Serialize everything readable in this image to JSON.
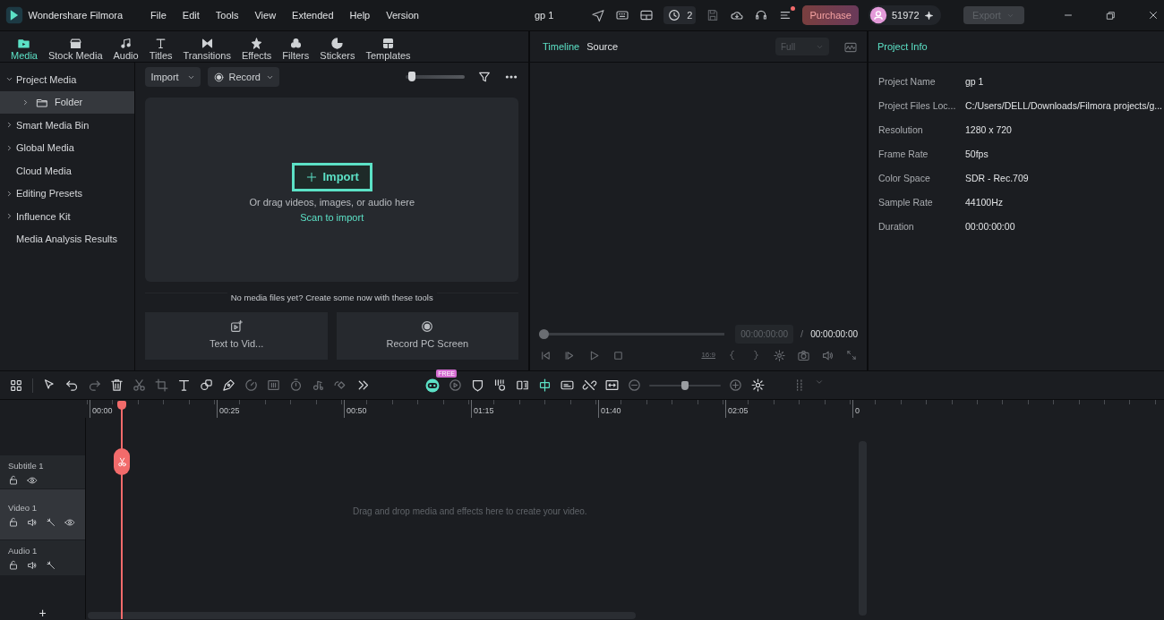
{
  "app": {
    "name": "Wondershare Filmora",
    "menu": [
      "File",
      "Edit",
      "Tools",
      "View",
      "Extended",
      "Help",
      "Version"
    ],
    "project_title": "gp 1",
    "undo_count": "2",
    "purchase": "Purchase",
    "credits": "51972",
    "export": {
      "label": "Export",
      "disabled": true
    }
  },
  "media_tabs": [
    {
      "kind": "media",
      "label": "Media",
      "selected": true
    },
    {
      "kind": "stock",
      "label": "Stock Media",
      "selected": false
    },
    {
      "kind": "audio",
      "label": "Audio",
      "selected": false
    },
    {
      "kind": "titles",
      "label": "Titles",
      "selected": false
    },
    {
      "kind": "transitions",
      "label": "Transitions",
      "selected": false
    },
    {
      "kind": "effects",
      "label": "Effects",
      "selected": false
    },
    {
      "kind": "filters",
      "label": "Filters",
      "selected": false
    },
    {
      "kind": "stickers",
      "label": "Stickers",
      "selected": false
    },
    {
      "kind": "templates",
      "label": "Templates",
      "selected": false
    }
  ],
  "sidebar": [
    {
      "label": "Project Media",
      "expandable": true,
      "expanded": true,
      "selected": false,
      "children": [
        {
          "label": "Folder",
          "expandable": true,
          "expanded": false,
          "selected": true
        }
      ]
    },
    {
      "label": "Smart Media Bin",
      "expandable": true,
      "expanded": false,
      "selected": false
    },
    {
      "label": "Global Media",
      "expandable": true,
      "expanded": false,
      "selected": false
    },
    {
      "label": "Cloud Media",
      "expandable": false,
      "selected": false
    },
    {
      "label": "Editing Presets",
      "expandable": true,
      "expanded": false,
      "selected": false
    },
    {
      "label": "Influence Kit",
      "expandable": true,
      "expanded": false,
      "selected": false
    },
    {
      "label": "Media Analysis Results",
      "expandable": false,
      "selected": false
    }
  ],
  "media_toolbar": {
    "import": "Import",
    "record": "Record",
    "thumb_size": {
      "level": 0.1
    }
  },
  "drop_zone": {
    "button": "Import",
    "hint": "Or drag videos, images, or audio here",
    "link": "Scan to import"
  },
  "create_prompt": "No media files yet? Create some now with these tools",
  "tools": [
    {
      "kind": "text-to-video",
      "label": "Text to Vid..."
    },
    {
      "kind": "record",
      "label": "Record PC Screen"
    }
  ],
  "preview": {
    "tabs": [
      {
        "label": "Timeline",
        "selected": true
      },
      {
        "label": "Source",
        "selected": false
      }
    ],
    "quality": "Full",
    "progress": {
      "level": 0
    },
    "current_time": "00:00:00:00",
    "separator": "/",
    "total_time": "00:00:00:00",
    "ratio": "16:9"
  },
  "project_info": {
    "title": "Project Info",
    "rows": [
      {
        "label": "Project Name",
        "value": "gp 1"
      },
      {
        "label": "Project Files Loc...",
        "value": "C:/Users/DELL/Downloads/Filmora projects/g..."
      },
      {
        "label": "Resolution",
        "value": "1280 x 720"
      },
      {
        "label": "Frame Rate",
        "value": "50fps"
      },
      {
        "label": "Color Space",
        "value": "SDR - Rec.709"
      },
      {
        "label": "Sample Rate",
        "value": "44100Hz"
      },
      {
        "label": "Duration",
        "value": "00:00:00:00"
      }
    ]
  },
  "timeline": {
    "free_badge": "FREE",
    "zoom": {
      "level": 0.5
    },
    "ruler": [
      "00:00",
      "00:25",
      "00:50",
      "01:15",
      "01:40",
      "02:05",
      "0"
    ],
    "tracks": [
      {
        "kind": "subtitle",
        "name": "Subtitle 1",
        "selected": false
      },
      {
        "kind": "video",
        "name": "Video 1",
        "selected": true
      },
      {
        "kind": "audio",
        "name": "Audio 1",
        "selected": false
      }
    ],
    "hint": "Drag and drop media and effects here to create your video.",
    "add": "+"
  }
}
